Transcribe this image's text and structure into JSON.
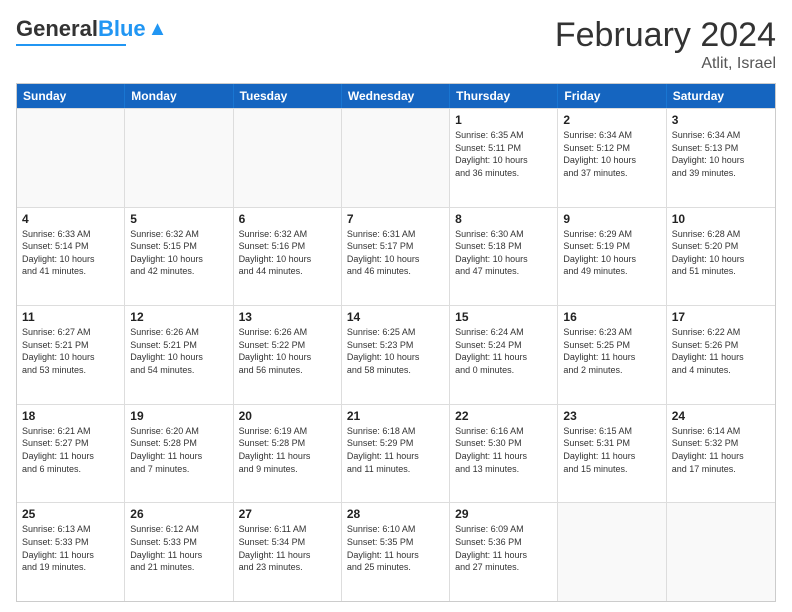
{
  "header": {
    "logo_general": "General",
    "logo_blue": "Blue",
    "title": "February 2024",
    "subtitle": "Atlit, Israel"
  },
  "weekdays": [
    "Sunday",
    "Monday",
    "Tuesday",
    "Wednesday",
    "Thursday",
    "Friday",
    "Saturday"
  ],
  "weeks": [
    [
      {
        "day": "",
        "info": ""
      },
      {
        "day": "",
        "info": ""
      },
      {
        "day": "",
        "info": ""
      },
      {
        "day": "",
        "info": ""
      },
      {
        "day": "1",
        "info": "Sunrise: 6:35 AM\nSunset: 5:11 PM\nDaylight: 10 hours\nand 36 minutes."
      },
      {
        "day": "2",
        "info": "Sunrise: 6:34 AM\nSunset: 5:12 PM\nDaylight: 10 hours\nand 37 minutes."
      },
      {
        "day": "3",
        "info": "Sunrise: 6:34 AM\nSunset: 5:13 PM\nDaylight: 10 hours\nand 39 minutes."
      }
    ],
    [
      {
        "day": "4",
        "info": "Sunrise: 6:33 AM\nSunset: 5:14 PM\nDaylight: 10 hours\nand 41 minutes."
      },
      {
        "day": "5",
        "info": "Sunrise: 6:32 AM\nSunset: 5:15 PM\nDaylight: 10 hours\nand 42 minutes."
      },
      {
        "day": "6",
        "info": "Sunrise: 6:32 AM\nSunset: 5:16 PM\nDaylight: 10 hours\nand 44 minutes."
      },
      {
        "day": "7",
        "info": "Sunrise: 6:31 AM\nSunset: 5:17 PM\nDaylight: 10 hours\nand 46 minutes."
      },
      {
        "day": "8",
        "info": "Sunrise: 6:30 AM\nSunset: 5:18 PM\nDaylight: 10 hours\nand 47 minutes."
      },
      {
        "day": "9",
        "info": "Sunrise: 6:29 AM\nSunset: 5:19 PM\nDaylight: 10 hours\nand 49 minutes."
      },
      {
        "day": "10",
        "info": "Sunrise: 6:28 AM\nSunset: 5:20 PM\nDaylight: 10 hours\nand 51 minutes."
      }
    ],
    [
      {
        "day": "11",
        "info": "Sunrise: 6:27 AM\nSunset: 5:21 PM\nDaylight: 10 hours\nand 53 minutes."
      },
      {
        "day": "12",
        "info": "Sunrise: 6:26 AM\nSunset: 5:21 PM\nDaylight: 10 hours\nand 54 minutes."
      },
      {
        "day": "13",
        "info": "Sunrise: 6:26 AM\nSunset: 5:22 PM\nDaylight: 10 hours\nand 56 minutes."
      },
      {
        "day": "14",
        "info": "Sunrise: 6:25 AM\nSunset: 5:23 PM\nDaylight: 10 hours\nand 58 minutes."
      },
      {
        "day": "15",
        "info": "Sunrise: 6:24 AM\nSunset: 5:24 PM\nDaylight: 11 hours\nand 0 minutes."
      },
      {
        "day": "16",
        "info": "Sunrise: 6:23 AM\nSunset: 5:25 PM\nDaylight: 11 hours\nand 2 minutes."
      },
      {
        "day": "17",
        "info": "Sunrise: 6:22 AM\nSunset: 5:26 PM\nDaylight: 11 hours\nand 4 minutes."
      }
    ],
    [
      {
        "day": "18",
        "info": "Sunrise: 6:21 AM\nSunset: 5:27 PM\nDaylight: 11 hours\nand 6 minutes."
      },
      {
        "day": "19",
        "info": "Sunrise: 6:20 AM\nSunset: 5:28 PM\nDaylight: 11 hours\nand 7 minutes."
      },
      {
        "day": "20",
        "info": "Sunrise: 6:19 AM\nSunset: 5:28 PM\nDaylight: 11 hours\nand 9 minutes."
      },
      {
        "day": "21",
        "info": "Sunrise: 6:18 AM\nSunset: 5:29 PM\nDaylight: 11 hours\nand 11 minutes."
      },
      {
        "day": "22",
        "info": "Sunrise: 6:16 AM\nSunset: 5:30 PM\nDaylight: 11 hours\nand 13 minutes."
      },
      {
        "day": "23",
        "info": "Sunrise: 6:15 AM\nSunset: 5:31 PM\nDaylight: 11 hours\nand 15 minutes."
      },
      {
        "day": "24",
        "info": "Sunrise: 6:14 AM\nSunset: 5:32 PM\nDaylight: 11 hours\nand 17 minutes."
      }
    ],
    [
      {
        "day": "25",
        "info": "Sunrise: 6:13 AM\nSunset: 5:33 PM\nDaylight: 11 hours\nand 19 minutes."
      },
      {
        "day": "26",
        "info": "Sunrise: 6:12 AM\nSunset: 5:33 PM\nDaylight: 11 hours\nand 21 minutes."
      },
      {
        "day": "27",
        "info": "Sunrise: 6:11 AM\nSunset: 5:34 PM\nDaylight: 11 hours\nand 23 minutes."
      },
      {
        "day": "28",
        "info": "Sunrise: 6:10 AM\nSunset: 5:35 PM\nDaylight: 11 hours\nand 25 minutes."
      },
      {
        "day": "29",
        "info": "Sunrise: 6:09 AM\nSunset: 5:36 PM\nDaylight: 11 hours\nand 27 minutes."
      },
      {
        "day": "",
        "info": ""
      },
      {
        "day": "",
        "info": ""
      }
    ]
  ]
}
